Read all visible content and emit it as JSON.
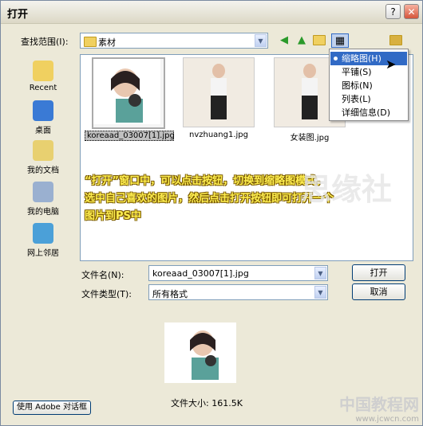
{
  "window": {
    "title": "打开",
    "help_label": "?",
    "close_label": "✕"
  },
  "lookin": {
    "label": "查找范围(I):",
    "value": "素材"
  },
  "toolbar_icons": [
    "back-icon",
    "up-folder-icon",
    "new-folder-icon",
    "view-menu-icon",
    "ps-folder-icon"
  ],
  "sidebar": {
    "items": [
      {
        "label": "Recent",
        "icon": "recent-icon"
      },
      {
        "label": "桌面",
        "icon": "desktop-icon"
      },
      {
        "label": "我的文档",
        "icon": "my-documents-icon"
      },
      {
        "label": "我的电脑",
        "icon": "my-computer-icon"
      },
      {
        "label": "网上邻居",
        "icon": "network-icon"
      }
    ]
  },
  "files": [
    {
      "name": "koreaad_03007[1].jpg",
      "selected": true
    },
    {
      "name": "nvzhuang1.jpg",
      "selected": false
    },
    {
      "name": "女装图.jpg",
      "selected": false
    }
  ],
  "note_lines": [
    "“打开”窗口中，可以点击按钮，切换到缩略图模式，",
    "选中自己喜欢的图片，然后点击打开按钮即可打开一个",
    "图片到PS中"
  ],
  "watermark": "思缘社",
  "view_menu": {
    "items": [
      {
        "label": "缩略图(H)",
        "active": true
      },
      {
        "label": "平铺(S)",
        "active": false
      },
      {
        "label": "图标(N)",
        "active": false
      },
      {
        "label": "列表(L)",
        "active": false
      },
      {
        "label": "详细信息(D)",
        "active": false
      }
    ]
  },
  "filename": {
    "label": "文件名(N):",
    "value": "koreaad_03007[1].jpg"
  },
  "filetype": {
    "label": "文件类型(T):",
    "value": "所有格式"
  },
  "buttons": {
    "open": "打开",
    "cancel": "取消",
    "adobe_dialog": "使用 Adobe 对话框"
  },
  "file_size": "文件大小: 161.5K",
  "site_watermark": {
    "cn": "中国教程网",
    "url": "www.jcwcn.com"
  },
  "colors": {
    "accent": "#316ac5",
    "note_fill": "#ffef50"
  }
}
